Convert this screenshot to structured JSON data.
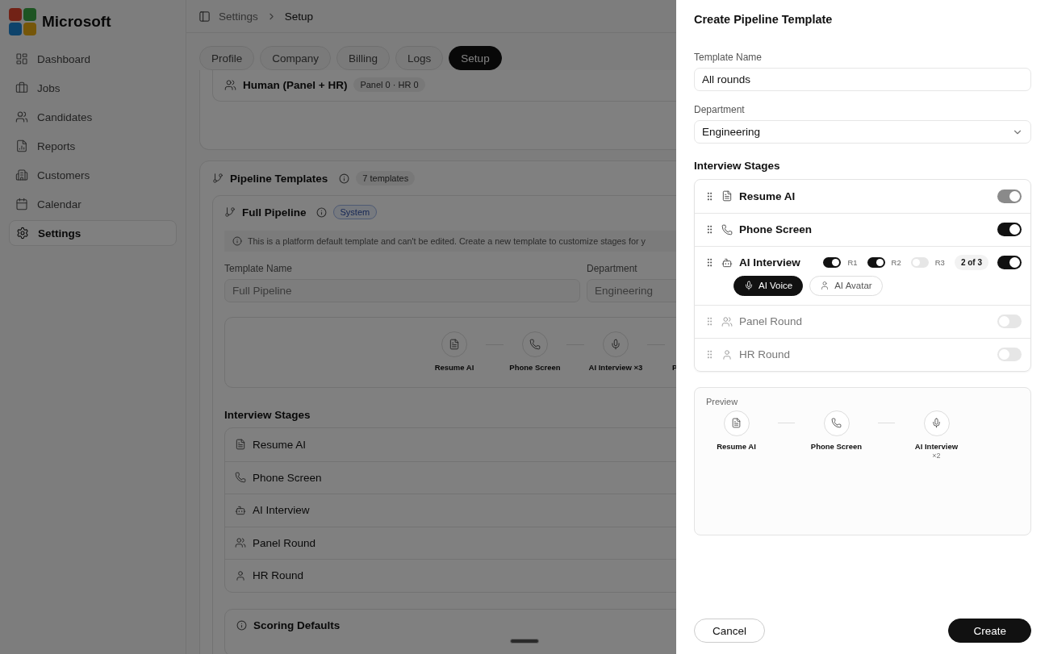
{
  "brand": {
    "name": "Microsoft"
  },
  "sidebar": {
    "items": [
      {
        "label": "Dashboard",
        "selected": false
      },
      {
        "label": "Jobs",
        "selected": false
      },
      {
        "label": "Candidates",
        "selected": false
      },
      {
        "label": "Reports",
        "selected": false
      },
      {
        "label": "Customers",
        "selected": false
      },
      {
        "label": "Calendar",
        "selected": false
      },
      {
        "label": "Settings",
        "selected": true
      }
    ]
  },
  "breadcrumb": [
    "Settings",
    "Setup"
  ],
  "tabs": [
    {
      "label": "Profile",
      "selected": false
    },
    {
      "label": "Company",
      "selected": false
    },
    {
      "label": "Billing",
      "selected": false
    },
    {
      "label": "Logs",
      "selected": false
    },
    {
      "label": "Setup",
      "selected": true
    }
  ],
  "human_card": {
    "title": "Human (Panel + HR)",
    "badge": "Panel 0 · HR 0"
  },
  "pipeline_templates": {
    "title": "Pipeline Templates",
    "count": "7 templates",
    "template": {
      "title": "Full Pipeline",
      "badge": "System",
      "notice": "This is a platform default template and can't be edited. Create a new template to customize stages for y",
      "fields": [
        {
          "label": "Template Name",
          "value": "Full Pipeline"
        },
        {
          "label": "Department",
          "value": "Engineering"
        }
      ],
      "flow": [
        {
          "label": "Resume AI"
        },
        {
          "label": "Phone Screen"
        },
        {
          "label": "AI Interview ×3"
        },
        {
          "label": "P"
        }
      ],
      "stages_title": "Interview Stages",
      "stages": [
        {
          "name": "Resume AI"
        },
        {
          "name": "Phone Screen"
        },
        {
          "name": "AI Interview"
        },
        {
          "name": "Panel Round"
        },
        {
          "name": "HR Round"
        }
      ]
    }
  },
  "scoring": {
    "title": "Scoring Defaults"
  },
  "drawer": {
    "title": "Create Pipeline Template",
    "fields": [
      {
        "label": "Template Name",
        "value": "All rounds",
        "kind": "input"
      },
      {
        "label": "Department",
        "value": "Engineering",
        "kind": "select"
      }
    ],
    "stages_title": "Interview Stages",
    "stages": [
      {
        "name": "Resume AI",
        "on": true,
        "disabled": true
      },
      {
        "name": "Phone Screen",
        "on": true,
        "disabled": false
      },
      {
        "name": "AI Interview",
        "on": true,
        "disabled": false,
        "rounds": [
          {
            "label": "R1",
            "on": true
          },
          {
            "label": "R2",
            "on": true
          },
          {
            "label": "R3",
            "on": false
          }
        ],
        "rounds_badge": "2 of 3",
        "modes": [
          {
            "label": "AI Voice",
            "selected": true
          },
          {
            "label": "AI Avatar",
            "selected": false
          }
        ]
      },
      {
        "name": "Panel Round",
        "on": false,
        "disabled": false
      },
      {
        "name": "HR Round",
        "on": false,
        "disabled": false
      }
    ],
    "preview": {
      "title": "Preview",
      "steps": [
        {
          "label": "Resume AI"
        },
        {
          "label": "Phone Screen"
        },
        {
          "label": "AI Interview",
          "count": "×2"
        }
      ]
    },
    "cancel": "Cancel",
    "create": "Create"
  }
}
